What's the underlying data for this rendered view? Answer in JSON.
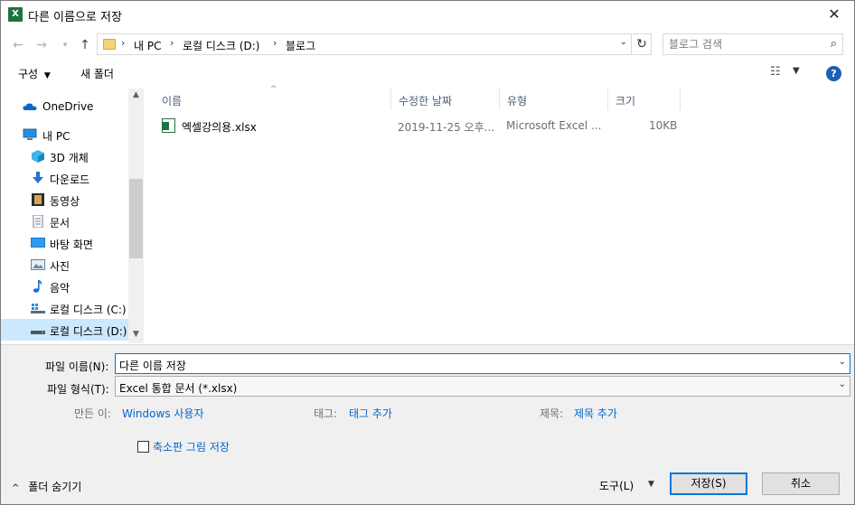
{
  "window": {
    "title": "다른 이름으로 저장",
    "app_icon": "X"
  },
  "address": {
    "crumbs": [
      "내 PC",
      "로컬 디스크 (D:)",
      "블로그"
    ],
    "search_placeholder": "블로그 검색"
  },
  "toolbar": {
    "organize_label": "구성",
    "new_folder_label": "새 폴더",
    "help_label": "?"
  },
  "tree": [
    {
      "label": "OneDrive",
      "icon": "cloud-icon",
      "indent": 1
    },
    {
      "label": "내 PC",
      "icon": "pc-icon",
      "indent": 1
    },
    {
      "label": "3D 개체",
      "icon": "cube-icon",
      "indent": 2
    },
    {
      "label": "다운로드",
      "icon": "download-icon",
      "indent": 2
    },
    {
      "label": "동영상",
      "icon": "video-icon",
      "indent": 2
    },
    {
      "label": "문서",
      "icon": "document-icon",
      "indent": 2
    },
    {
      "label": "바탕 화면",
      "icon": "desktop-icon",
      "indent": 2
    },
    {
      "label": "사진",
      "icon": "picture-icon",
      "indent": 2
    },
    {
      "label": "음악",
      "icon": "music-icon",
      "indent": 2
    },
    {
      "label": "로컬 디스크 (C:)",
      "icon": "drive-c-icon",
      "indent": 2
    },
    {
      "label": "로컬 디스크 (D:)",
      "icon": "drive-d-icon",
      "indent": 2,
      "selected": true
    }
  ],
  "columns": {
    "name": "이름",
    "date": "수정한 날짜",
    "type": "유형",
    "size": "크기"
  },
  "files": [
    {
      "name": "엑셀강의용.xlsx",
      "date": "2019-11-25 오후...",
      "type": "Microsoft Excel ...",
      "size": "10KB"
    }
  ],
  "form": {
    "filename_label": "파일 이름(N):",
    "filename_value": "다른 이름 저장",
    "filetype_label": "파일 형식(T):",
    "filetype_value": "Excel 통합 문서 (*.xlsx)",
    "author_label": "만든 이:",
    "author_value": "Windows 사용자",
    "tags_label": "태그:",
    "tags_value": "태그 추가",
    "title_label": "제목:",
    "title_value": "제목 추가",
    "thumbnail_label": "축소판 그림 저장",
    "hide_folders_label": "폴더 숨기기",
    "tools_label": "도구(L)",
    "save_label": "저장(S)",
    "cancel_label": "취소"
  }
}
